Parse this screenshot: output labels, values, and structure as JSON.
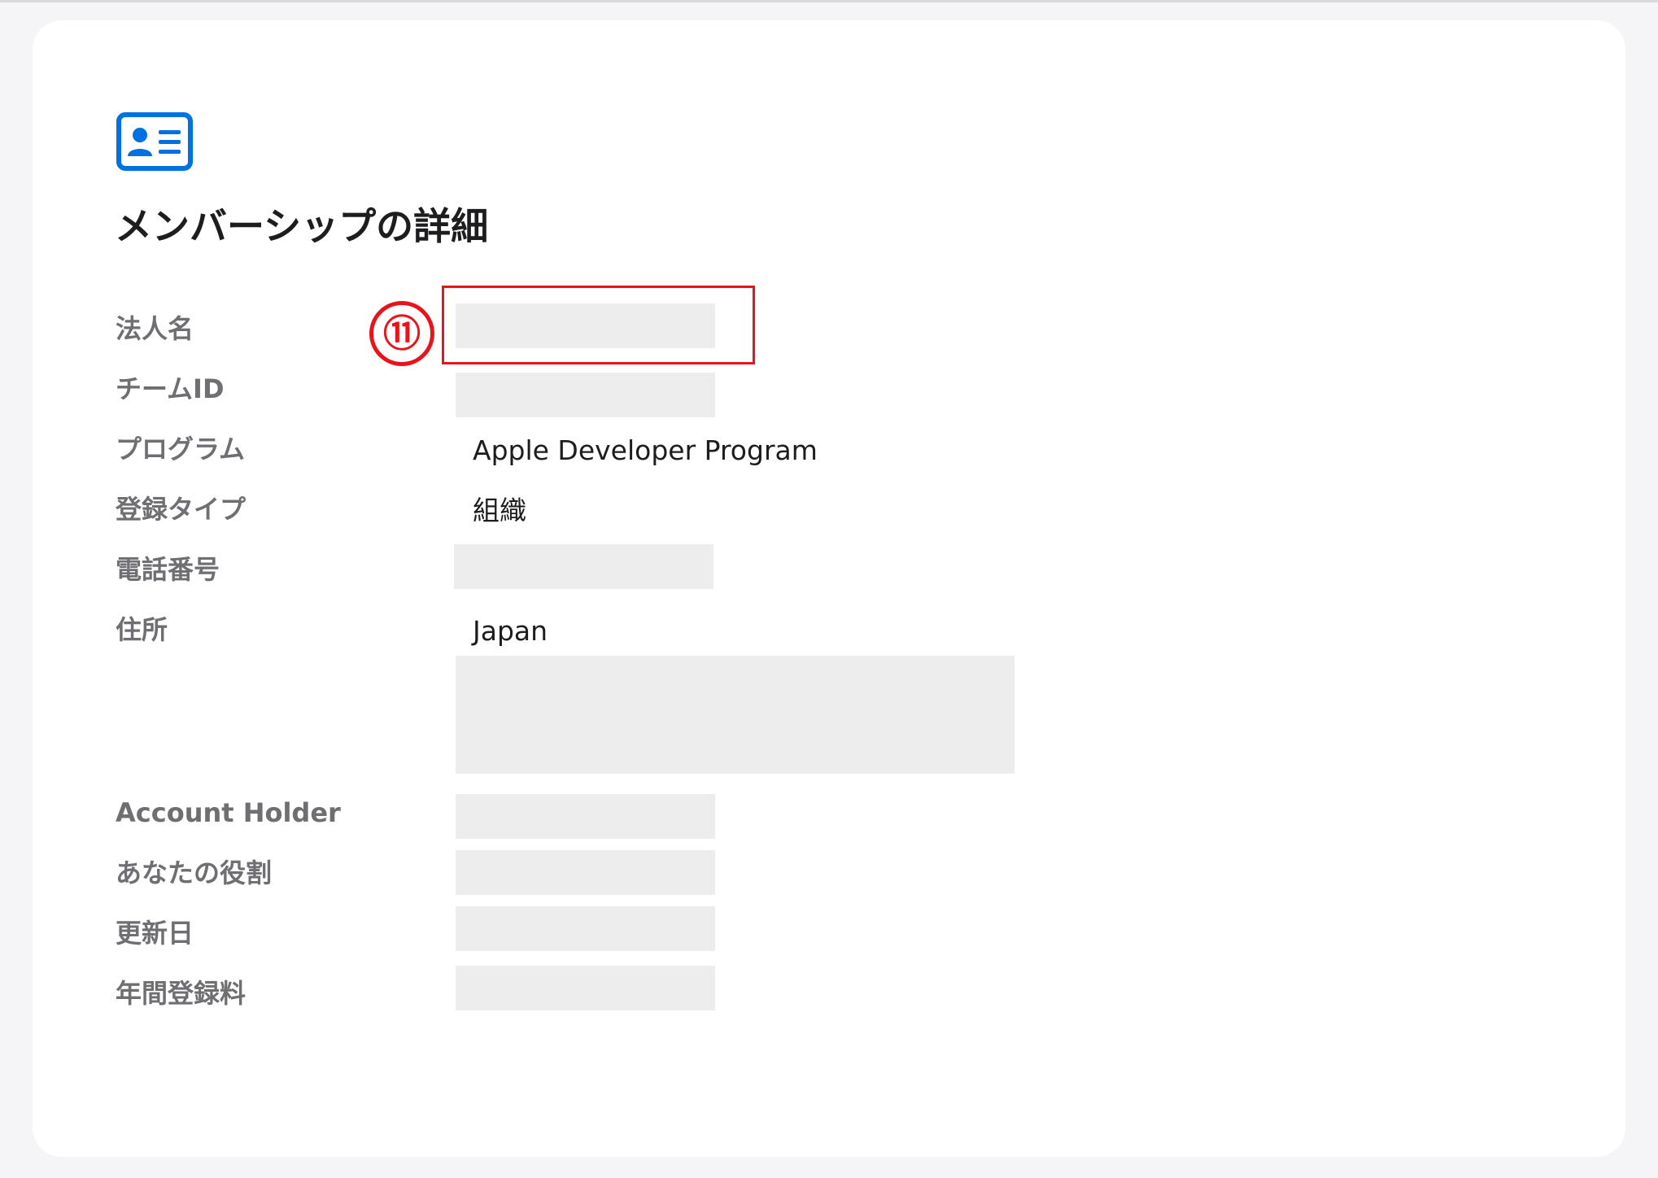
{
  "annotation": {
    "step_marker": "⑪"
  },
  "membership": {
    "title": "メンバーシップの詳細",
    "icon": "id-card-icon",
    "accent_color": "#0071e3",
    "highlight_color": "#e8141b",
    "rows": [
      {
        "label": "法人名",
        "value": null,
        "redacted": true
      },
      {
        "label": "チームID",
        "value": null,
        "redacted": true
      },
      {
        "label": "プログラム",
        "value": "Apple Developer Program",
        "redacted": false
      },
      {
        "label": "登録タイプ",
        "value": "組織",
        "redacted": false
      },
      {
        "label": "電話番号",
        "value": null,
        "redacted": true
      },
      {
        "label": "住所",
        "value": "Japan",
        "redacted": true
      },
      {
        "label": "Account Holder",
        "value": null,
        "redacted": true
      },
      {
        "label": "あなたの役割",
        "value": null,
        "redacted": true
      },
      {
        "label": "更新日",
        "value": null,
        "redacted": true
      },
      {
        "label": "年間登録料",
        "value": null,
        "redacted": true
      }
    ]
  }
}
